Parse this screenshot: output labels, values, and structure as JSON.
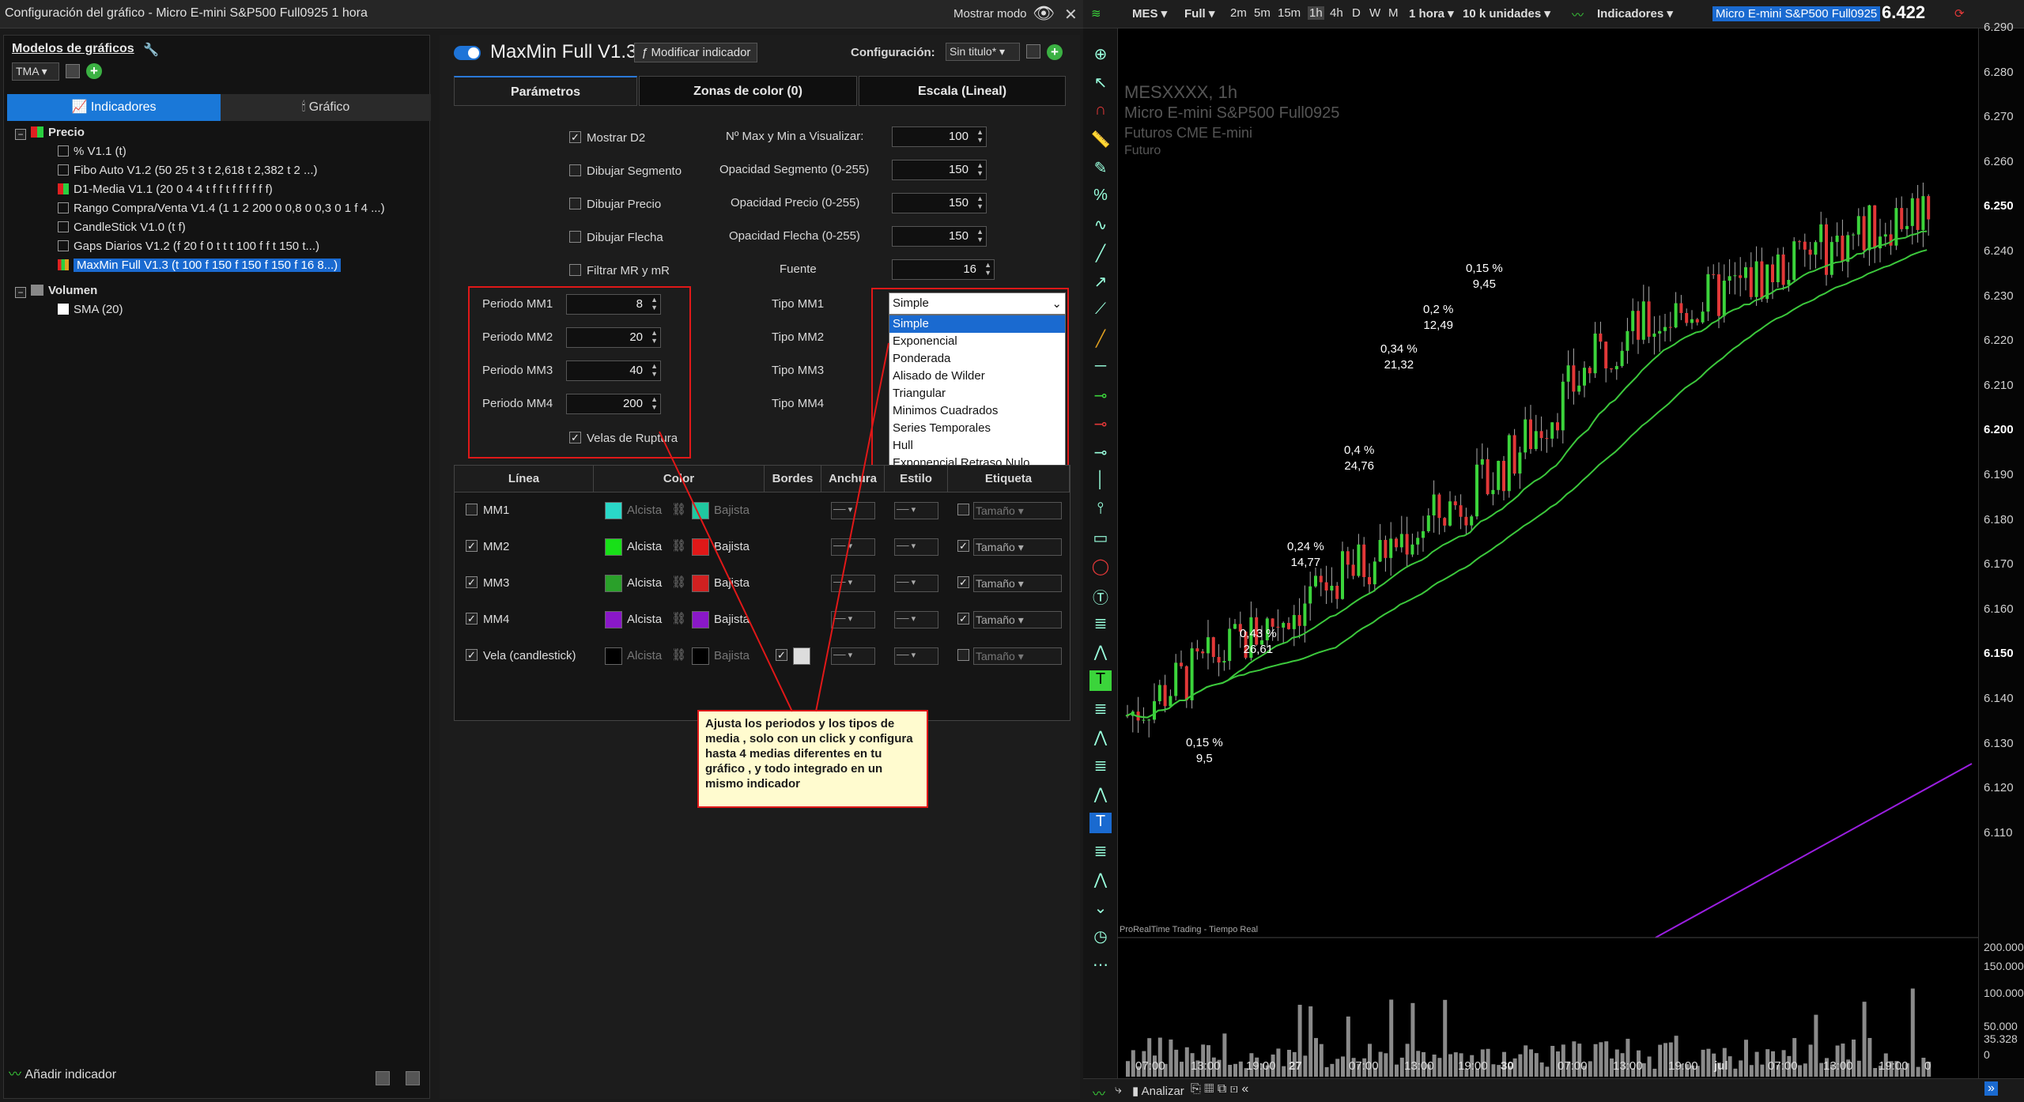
{
  "window": {
    "title": "Configuración del gráfico - Micro E-mini S&P500 Full0925 1 hora",
    "mode_label": "Mostrar modo"
  },
  "left_panel": {
    "header": "Modelos de gráficos",
    "template": "TMA",
    "tabs": [
      "Indicadores",
      "Gráfico"
    ],
    "tree": {
      "group1": "Precio",
      "items": [
        "% V1.1 (t)",
        "Fibo Auto V1.2 (50 25 t 3 t 2,618 t 2,382 t 2 ...)",
        "D1-Media V1.1 (20 0 4 4 t f f t f f f f f f)",
        "Rango Compra/Venta V1.4 (1 1 2 200 0 0,8 0 0,3 0 1 f 4 ...)",
        "CandleStick V1.0 (t f)",
        "Gaps Diarios V1.2 (f 20 f 0 t t t 100 f f t 150 t...)",
        "MaxMin Full V1.3 (t 100 f 150 f 150 f 150 f 16 8...)"
      ],
      "group2": "Volumen",
      "items2": [
        "SMA (20)"
      ]
    },
    "footer": "Añadir indicador"
  },
  "main": {
    "title": "MaxMin Full V1.3",
    "modify_btn": "Modificar indicador",
    "config_label": "Configuración:",
    "config_value": "Sin titulo*",
    "tabs": [
      "Parámetros",
      "Zonas de color (0)",
      "Escala (Lineal)"
    ],
    "checks": [
      "Mostrar D2",
      "Dibujar Segmento",
      "Dibujar Precio",
      "Dibujar Flecha",
      "Filtrar MR y mR"
    ],
    "right_labels": [
      "Nº Max y Min a Visualizar:",
      "Opacidad Segmento (0-255)",
      "Opacidad Precio (0-255)",
      "Opacidad Flecha (0-255)",
      "Fuente"
    ],
    "right_values": [
      "100",
      "150",
      "150",
      "150",
      "16"
    ],
    "periods": [
      {
        "label": "Periodo MM1",
        "value": "8"
      },
      {
        "label": "Periodo MM2",
        "value": "20"
      },
      {
        "label": "Periodo MM3",
        "value": "40"
      },
      {
        "label": "Periodo MM4",
        "value": "200"
      }
    ],
    "types": [
      "Tipo MM1",
      "Tipo MM2",
      "Tipo MM3",
      "Tipo MM4"
    ],
    "type_selected": "Simple",
    "type_options": [
      "Simple",
      "Exponencial",
      "Ponderada",
      "Alisado de Wilder",
      "Triangular",
      "Minimos Cuadrados",
      "Series Temporales",
      "Hull",
      "Exponencial Retraso Nulo"
    ],
    "velas": "Velas de Ruptura",
    "table": {
      "headers": [
        "Línea",
        "Color",
        "Bordes",
        "Anchura",
        "Estilo",
        "Etiqueta"
      ],
      "rows": [
        {
          "name": "MM1",
          "up": "Alcista",
          "down": "Bajista",
          "tag": "Tamaño",
          "c1": "#2ad8c8",
          "c2": "#20c8a0",
          "dim": true
        },
        {
          "name": "MM2",
          "up": "Alcista",
          "down": "Bajista",
          "tag": "Tamaño",
          "c1": "#18e018",
          "c2": "#e01818"
        },
        {
          "name": "MM3",
          "up": "Alcista",
          "down": "Bajista",
          "tag": "Tamaño",
          "c1": "#2aa02a",
          "c2": "#d02020"
        },
        {
          "name": "MM4",
          "up": "Alcista",
          "down": "Bajista",
          "tag": "Tamaño",
          "c1": "#8a18c8",
          "c2": "#8a18c8"
        },
        {
          "name": "Vela (candlestick)",
          "up": "Alcista",
          "down": "Bajista",
          "tag": "Tamaño",
          "c1": "#000000",
          "c2": "#000000",
          "dim": true
        }
      ]
    },
    "note": "Ajusta los periodos y los tipos de media , solo con un click y configura hasta 4 medias diferentes en tu gráfico , y todo integrado en un mismo indicador"
  },
  "chart": {
    "symbol": "MES",
    "full": "Full",
    "timeframes": [
      "2m",
      "5m",
      "15m",
      "1h",
      "4h",
      "D",
      "W",
      "M"
    ],
    "interval": "1 hora",
    "units": "10 k unidades",
    "indicators": "Indicadores",
    "instrument": "Micro E-mini S&P500 Full0925",
    "last_price": "6.422",
    "watermark": [
      "MESXXXX, 1h",
      "Micro E-mini S&P500 Full0925",
      "Futuros CME E-mini",
      "Futuro"
    ],
    "price_axis": [
      "6.290",
      "6.280",
      "6.270",
      "6.260",
      "6.250",
      "6.240",
      "6.230",
      "6.220",
      "6.210",
      "6.200",
      "6.190",
      "6.180",
      "6.170",
      "6.160",
      "6.150",
      "6.140",
      "6.130",
      "6.120",
      "6.110"
    ],
    "vol_axis": [
      "200.000",
      "150.000",
      "100.000",
      "50.000",
      "35.328",
      "0"
    ],
    "annotations": [
      [
        "0,15 %",
        "9,5"
      ],
      [
        "0,43 %",
        "26,61"
      ],
      [
        "0,24 %",
        "14,77"
      ],
      [
        "0,4 %",
        "24,76"
      ],
      [
        "0,34 %",
        "21,32"
      ],
      [
        "0,2 %",
        "12,49"
      ],
      [
        "0,15 %",
        "9,45"
      ]
    ],
    "time_labels": [
      "07:00",
      "13:00",
      "19:00",
      "27",
      "07:00",
      "13:00",
      "19:00",
      "30",
      "07:00",
      "13:00",
      "19:00",
      "jul",
      "07:00",
      "13:00",
      "19:00",
      "0"
    ],
    "footer_left": "ProRealTime Trading - Tiempo Real",
    "analyze": "Analizar",
    "colors": {
      "up": "#3bd43b",
      "down": "#e23838",
      "ma_green": "#3cc83c",
      "ma_purple": "#9a1ee0"
    }
  }
}
